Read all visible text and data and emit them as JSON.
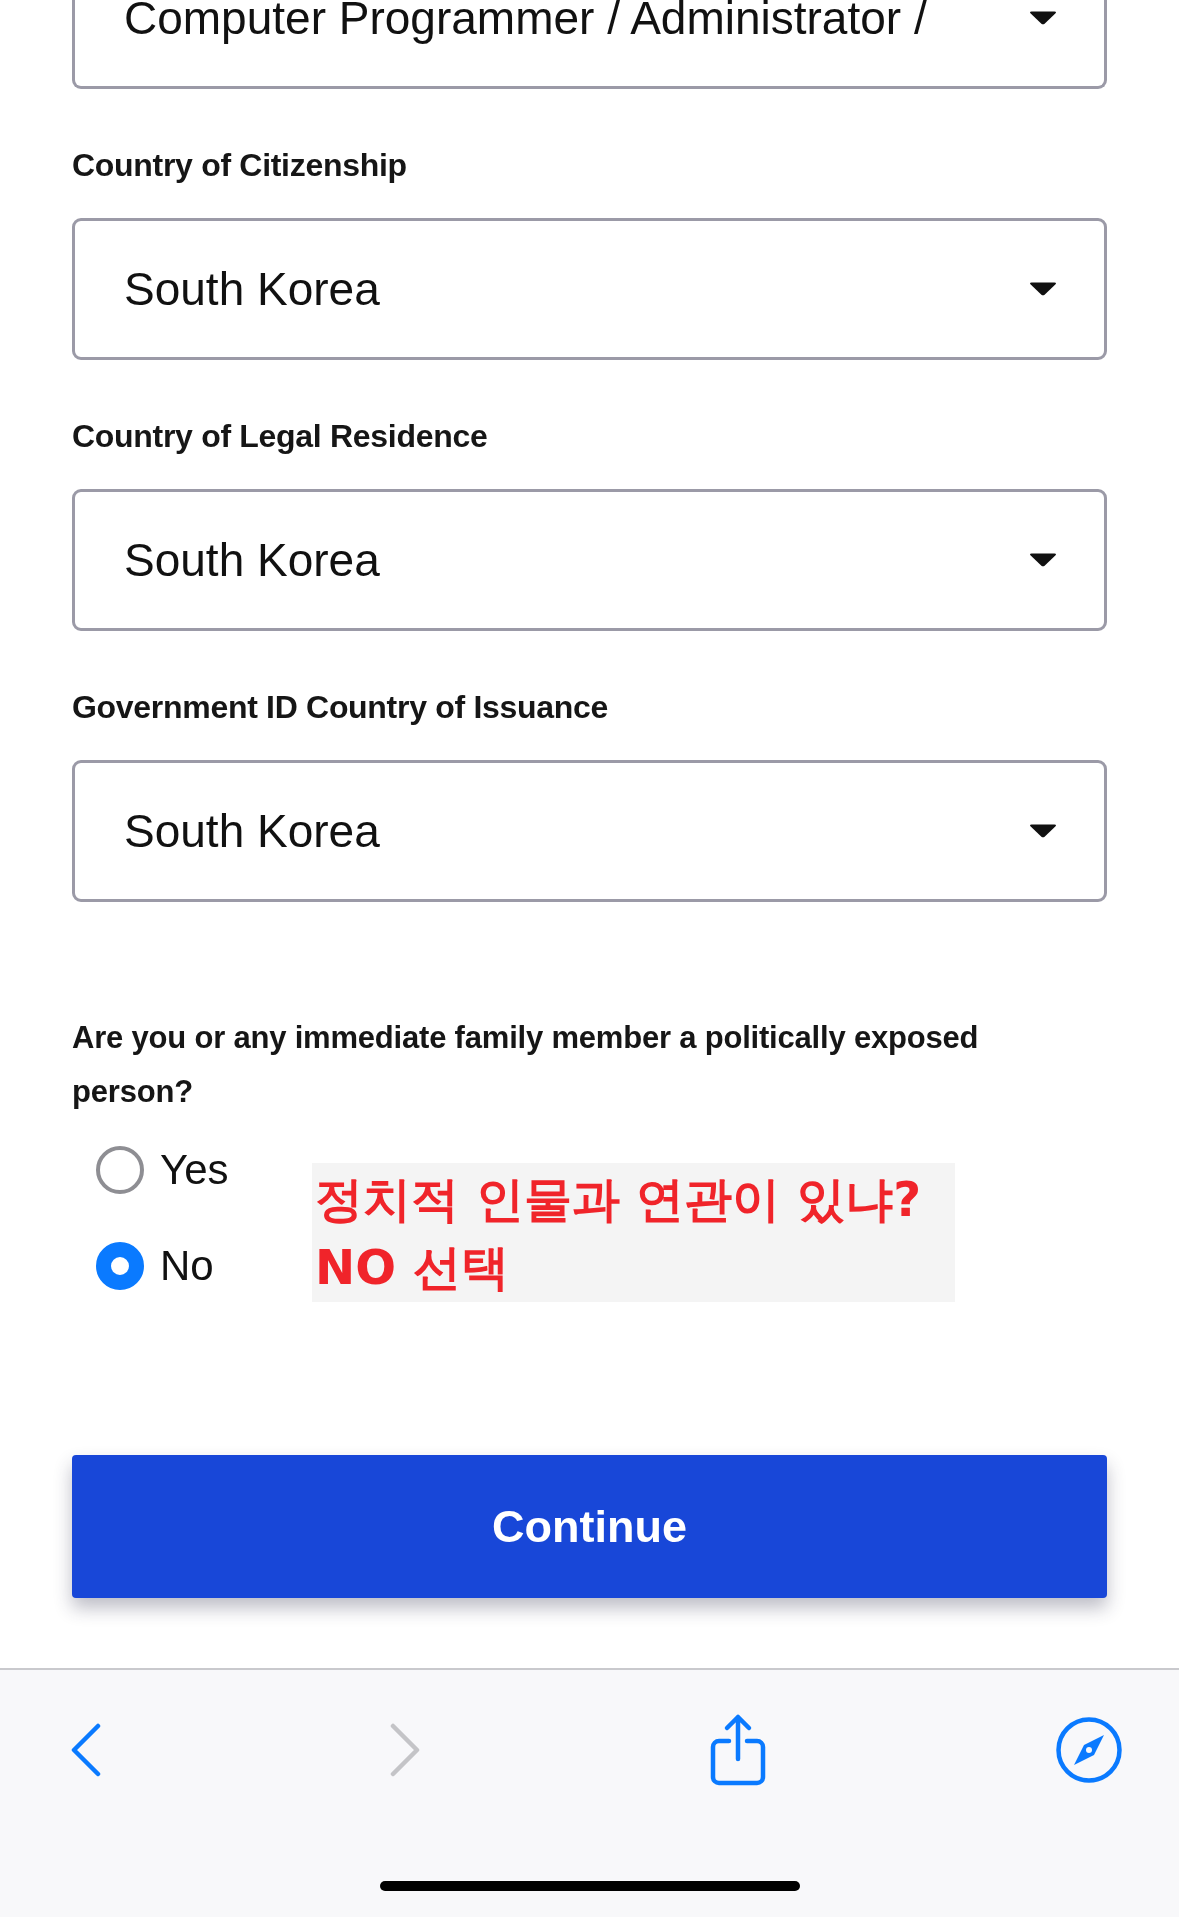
{
  "form": {
    "fields": [
      {
        "value": "Computer Programmer / Administrator /"
      },
      {
        "label": "Country of Citizenship",
        "value": "South Korea"
      },
      {
        "label": "Country of Legal Residence",
        "value": "South Korea"
      },
      {
        "label": "Government ID Country of Issuance",
        "value": "South Korea"
      }
    ]
  },
  "question": {
    "text": "Are you or any immediate family member a politically exposed person?",
    "options": [
      {
        "label": "Yes",
        "selected": false
      },
      {
        "label": "No",
        "selected": true
      }
    ]
  },
  "annotation": {
    "lines": [
      "정치적 인물과 연관이 있냐?",
      "NO 선택"
    ]
  },
  "continue_button": {
    "label": "Continue"
  },
  "toolbar": {
    "buttons": [
      {
        "kind": "back",
        "disabled": false
      },
      {
        "kind": "forward",
        "disabled": true
      },
      {
        "kind": "share",
        "disabled": false
      },
      {
        "kind": "compass",
        "disabled": false
      }
    ]
  }
}
